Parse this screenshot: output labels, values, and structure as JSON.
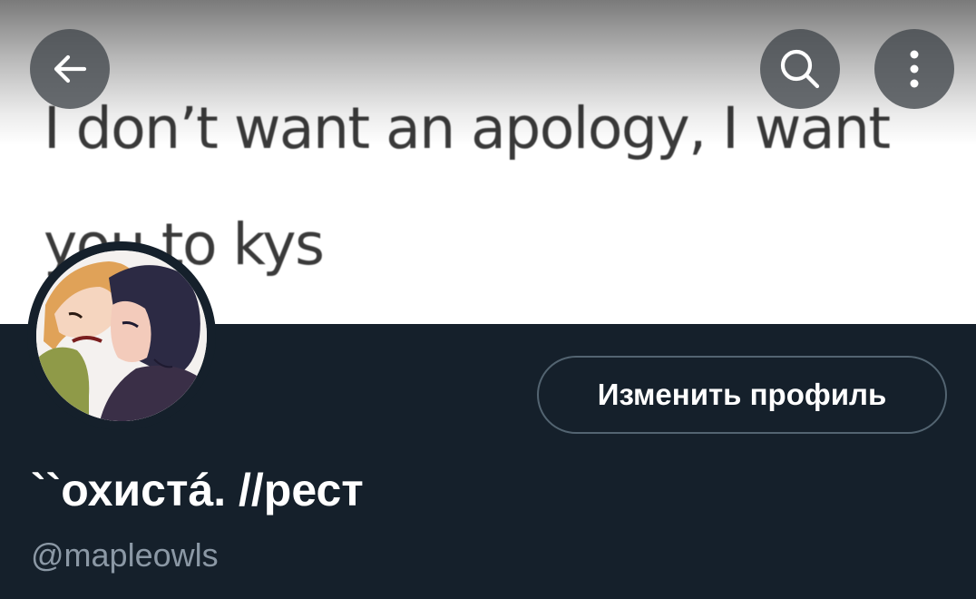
{
  "banner": {
    "text": "I don’t want an apology, I want\nyou to kys"
  },
  "topbar": {
    "back_icon": "arrow-left-icon",
    "search_icon": "search-icon",
    "more_icon": "more-vertical-icon"
  },
  "profile": {
    "display_name": "``охистá. //рест",
    "handle": "@mapleowls",
    "edit_button_label": "Изменить профиль"
  },
  "colors": {
    "background": "#15202b",
    "button_border": "#536471",
    "handle_text": "#8b98a5",
    "primary_text": "#ffffff"
  }
}
